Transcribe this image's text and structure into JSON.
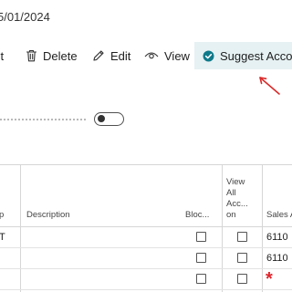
{
  "header": {
    "date_text": "5/01/2024"
  },
  "toolbar": {
    "cut_label": "st",
    "delete_label": "Delete",
    "edit_label": "Edit",
    "view_label": "View",
    "suggest_label": "Suggest Accour"
  },
  "colors": {
    "accent": "#0f7a8a",
    "annotation_arrow": "#d92b2b",
    "required_marker": "#e0242c",
    "suggest_bg": "#e6f1f3"
  },
  "toggle": {
    "on": false
  },
  "table": {
    "columns": {
      "cut_col": "p",
      "description": "Description",
      "blocked": "Bloc...",
      "view_all_line1": "View",
      "view_all_line2": "All",
      "view_all_line3": "Acc...",
      "view_all_line4": "on",
      "sales": "Sales A"
    },
    "rows": [
      {
        "cut_col": "T",
        "blocked": false,
        "view_all": false,
        "sales": "6110"
      },
      {
        "cut_col": "",
        "blocked": false,
        "view_all": false,
        "sales": "6110"
      },
      {
        "cut_col": "",
        "blocked": false,
        "view_all": false,
        "sales_required": "*"
      }
    ]
  }
}
